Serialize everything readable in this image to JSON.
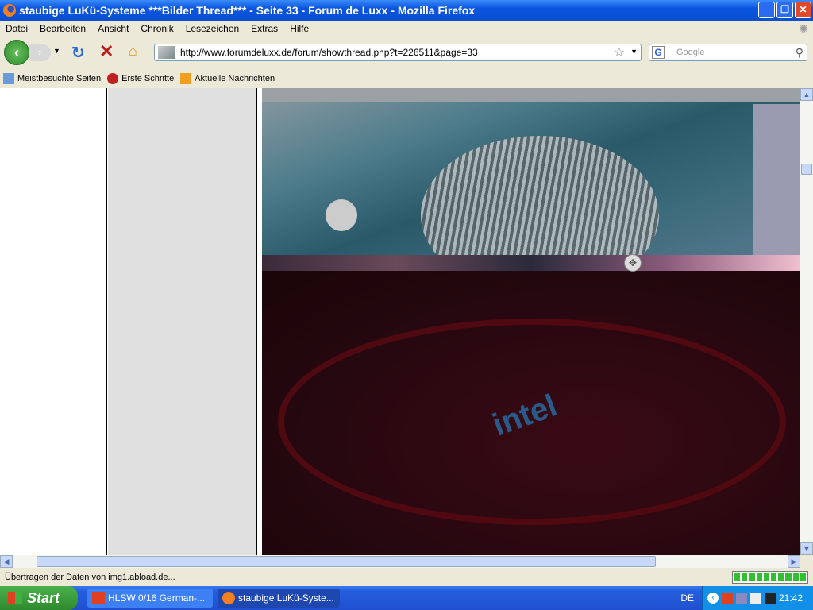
{
  "window": {
    "title": "staubige LuKü-Systeme ***Bilder Thread*** - Seite 33 - Forum de Luxx - Mozilla Firefox"
  },
  "menu": [
    "Datei",
    "Bearbeiten",
    "Ansicht",
    "Chronik",
    "Lesezeichen",
    "Extras",
    "Hilfe"
  ],
  "nav": {
    "url": "http://www.forumdeluxx.de/forum/showthread.php?t=226511&page=33",
    "search_placeholder": "Google"
  },
  "bookmarks": [
    "Meistbesuchte Seiten",
    "Erste Schritte",
    "Aktuelle Nachrichten"
  ],
  "page": {
    "photo_text": "intel"
  },
  "status": {
    "text": "Übertragen der Daten von img1.abload.de...",
    "progress": 1.0
  },
  "taskbar": {
    "start": "Start",
    "tasks": [
      "HLSW   0/16 German-...",
      "staubige LuKü-Syste..."
    ],
    "lang": "DE",
    "clock": "21:42"
  }
}
